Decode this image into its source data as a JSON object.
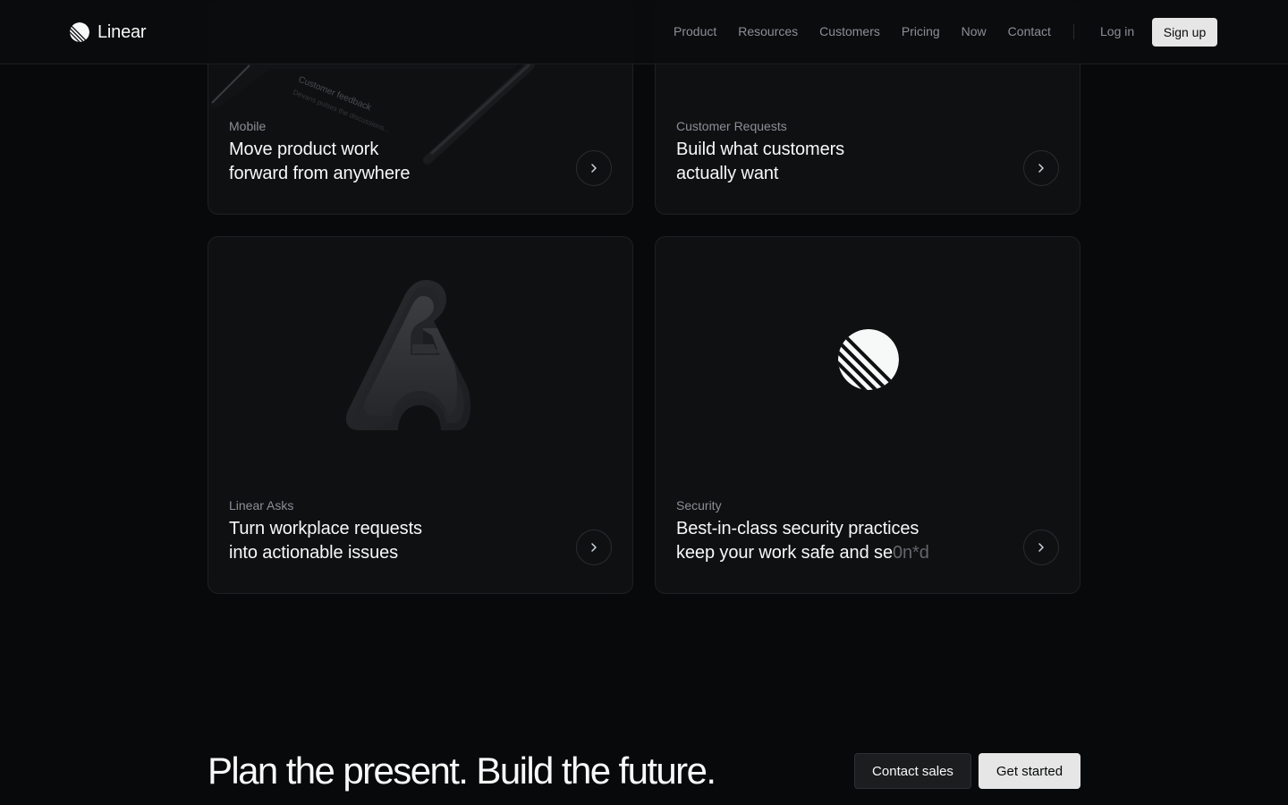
{
  "header": {
    "logo_text": "Linear",
    "nav": [
      "Product",
      "Resources",
      "Customers",
      "Pricing",
      "Now",
      "Contact"
    ],
    "login_label": "Log in",
    "signup_label": "Sign up"
  },
  "cards": [
    {
      "label": "Mobile",
      "title_line1": "Move product work",
      "title_line2": "forward from anywhere",
      "image_text1": "Customer feedback",
      "image_text2": "Devans pulses the discussions..."
    },
    {
      "label": "Customer Requests",
      "title_line1": "Build what customers",
      "title_line2": "actually want"
    },
    {
      "label": "Linear Asks",
      "title_line1": "Turn workplace requests",
      "title_line2": "into actionable issues"
    },
    {
      "label": "Security",
      "title_line1": "Best-in-class security practices",
      "title_line2_plain": "keep your work safe and se",
      "title_line2_scrambled": "0n*d"
    }
  ],
  "cta": {
    "title": "Plan the present. Build the future.",
    "contact_label": "Contact sales",
    "start_label": "Get started"
  },
  "icons": {
    "logo": "linear-logo-icon",
    "chevron": "chevron-right-icon",
    "asks": "linear-asks-icon",
    "security": "linear-logo-icon"
  }
}
